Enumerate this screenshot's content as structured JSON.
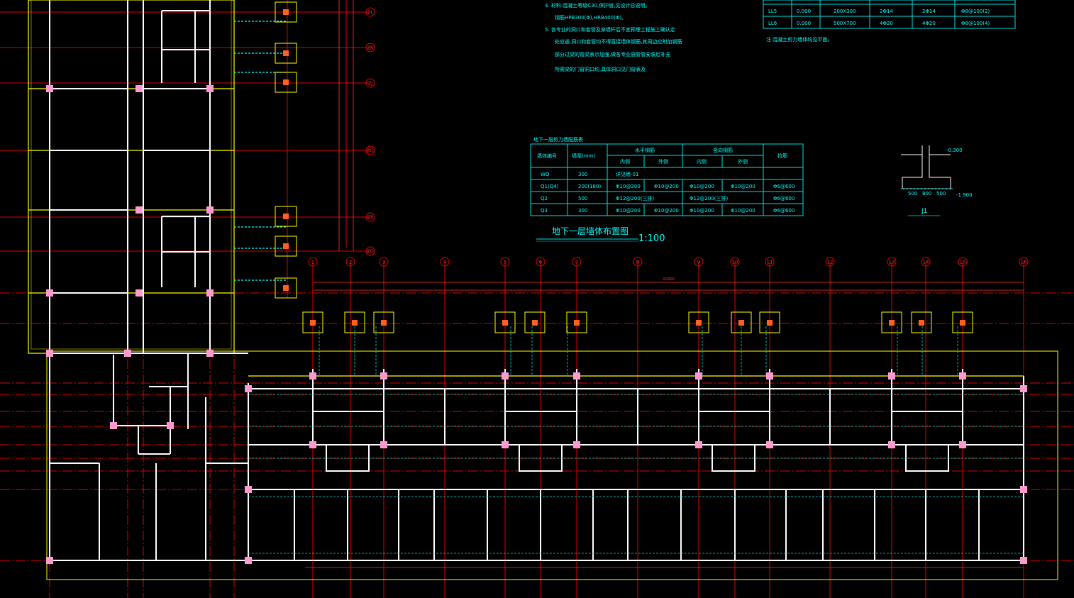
{
  "notes": {
    "items": [
      "4. 材料:混凝土等级C30,保护层,见设计总说明。",
      "钢筋HPB300(Φ),HRB400(Φ)。",
      "5. 各专业的洞口和套管及穿墙杆后不宜预埋工程施工确认定",
      "处应通,洞口和套管均不得直接墙体钢筋,其周边应附加钢筋",
      "部分过梁的管梁表示加强,做各专业施管管安装后补充",
      "所需梁的门窗洞口均,具体洞口见门窗表及",
      "注:混凝土剪力墙体均见平面。"
    ]
  },
  "beam_table": {
    "rows": [
      [
        "LL5",
        "0.000",
        "200X300",
        "2Φ14",
        "2Φ14",
        "Φ8@100(2)"
      ],
      [
        "LL6",
        "0.000",
        "500X700",
        "4Φ20",
        "4Φ20",
        "Φ8@100(4)"
      ]
    ]
  },
  "wall_table": {
    "title": "地下一层剪力墙配筋表",
    "headers": [
      "墙体编号",
      "墙厚(mm)",
      "水平钢筋",
      "竖向钢筋",
      "拉筋"
    ],
    "subheaders": [
      "内侧",
      "外侧",
      "内侧",
      "外侧"
    ],
    "rows": [
      [
        "WQ",
        "300",
        "详见墙-01",
        "",
        "",
        "",
        ""
      ],
      [
        "Q1(Q4)",
        "200(180)",
        "Φ10@200",
        "Φ10@200",
        "Φ10@200",
        "Φ10@200",
        "Φ6@600"
      ],
      [
        "Q2",
        "500",
        "Φ12@200(三排)",
        "",
        "Φ12@200(三排)",
        "",
        "Φ6@600"
      ],
      [
        "Q3",
        "300",
        "Φ10@200",
        "Φ10@200",
        "Φ10@200",
        "Φ10@200",
        "Φ6@600"
      ]
    ]
  },
  "plan_title": "地下一层墙体布置图",
  "plan_scale": "1:100",
  "detail": {
    "label": "J1",
    "dims": [
      "500",
      "800",
      "500"
    ],
    "elev_top": "-0.300",
    "elev_bot": "-1.900"
  },
  "axes_right": [
    "2L",
    "2K",
    "2J",
    "2G",
    "2E",
    "2D"
  ],
  "axes_top": [
    "1",
    "2",
    "3",
    "4",
    "5",
    "6",
    "7",
    "8",
    "9",
    "10",
    "11",
    "12",
    "13",
    "14",
    "15",
    "16"
  ],
  "overall_dim": "62000",
  "colors": {
    "background": "#000000",
    "axis": "#ff0000",
    "wall": "#ffff00",
    "text": "#00ffff",
    "annotation": "#ff00ff",
    "column": "#ffffff"
  }
}
